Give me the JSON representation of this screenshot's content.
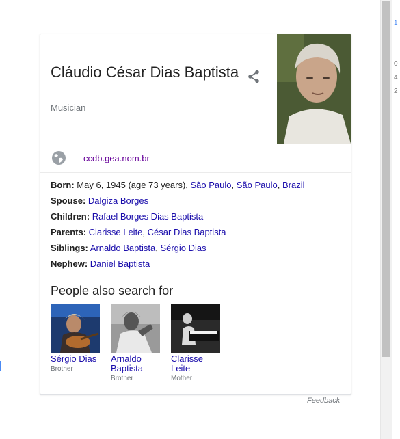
{
  "entity": {
    "name": "Cláudio César Dias Baptista",
    "type": "Musician"
  },
  "website": "ccdb.gea.nom.br",
  "facts": {
    "born": {
      "label": "Born:",
      "text": "May 6, 1945 (age 73 years),",
      "places": [
        "São Paulo",
        "São Paulo",
        "Brazil"
      ]
    },
    "spouse": {
      "label": "Spouse:",
      "values": [
        "Dalgiza Borges"
      ]
    },
    "children": {
      "label": "Children:",
      "values": [
        "Rafael Borges Dias Baptista"
      ]
    },
    "parents": {
      "label": "Parents:",
      "values": [
        "Clarisse Leite",
        "César Dias Baptista"
      ]
    },
    "siblings": {
      "label": "Siblings:",
      "values": [
        "Arnaldo Baptista",
        "Sérgio Dias"
      ]
    },
    "nephew": {
      "label": "Nephew:",
      "values": [
        "Daniel Baptista"
      ]
    }
  },
  "people_also_search": {
    "heading": "People also search for",
    "people": [
      {
        "name": "Sérgio Dias",
        "relation": "Brother"
      },
      {
        "name": "Arnaldo Baptista",
        "relation": "Brother"
      },
      {
        "name": "Clarisse Leite",
        "relation": "Mother"
      }
    ]
  },
  "feedback_label": "Feedback",
  "colors": {
    "link": "#1a0dab",
    "visited": "#660099",
    "muted": "#70757a"
  },
  "icons": {
    "share": "share-icon",
    "globe": "globe-icon"
  },
  "edge_marks": [
    "1",
    "0",
    "4",
    "2"
  ]
}
